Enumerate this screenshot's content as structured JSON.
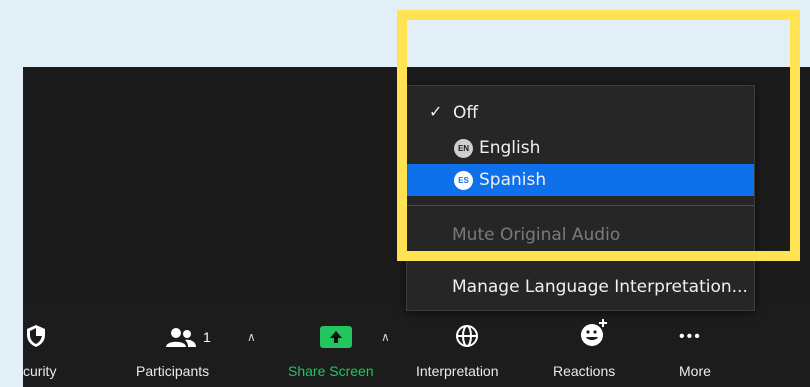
{
  "toolbar": {
    "security_label": "curity",
    "participants_label": "Participants",
    "participants_count": "1",
    "share_label": "Share Screen",
    "interpretation_label": "Interpretation",
    "reactions_label": "Reactions",
    "more_label": "More",
    "share_color": "#22c55e"
  },
  "menu": {
    "items": [
      {
        "label": "Off",
        "checked": true
      },
      {
        "badge": "EN",
        "label": "English"
      },
      {
        "badge": "ES",
        "label": "Spanish",
        "selected": true
      }
    ],
    "mute_label": "Mute Original Audio",
    "manage_label": "Manage Language Interpretation...",
    "selected_color": "#0e71eb"
  },
  "highlight": {
    "color": "#ffe352"
  }
}
